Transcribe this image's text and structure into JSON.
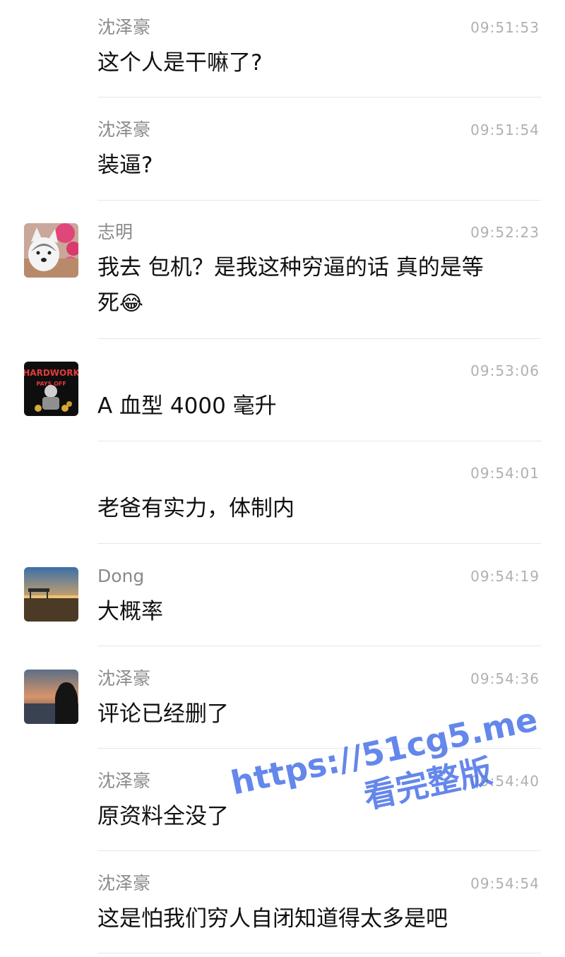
{
  "messages": [
    {
      "sender": "沈泽豪",
      "time": "09:51:53",
      "text": "这个人是干嘛了?"
    },
    {
      "sender": "沈泽豪",
      "time": "09:51:54",
      "text": "装逼?"
    },
    {
      "sender": "志明",
      "time": "09:52:23",
      "text": "我去 包机？是我这种穷逼的话 真的是等",
      "text2": "死",
      "emoji": "😂",
      "avatar": "husky-dog-avatar"
    },
    {
      "sender": "",
      "time": "09:53:06",
      "text": "A 血型 4000 毫升",
      "avatar": "hardwork-pays-off-avatar",
      "avatar_text_1": "HARDWORK",
      "avatar_text_2": "PAYS OFF"
    },
    {
      "sender": "",
      "time": "09:54:01",
      "text": "老爸有实力，体制内"
    },
    {
      "sender": "Dong",
      "time": "09:54:19",
      "text": "大概率",
      "avatar": "sunset-landscape-avatar"
    },
    {
      "sender": "沈泽豪",
      "time": "09:54:36",
      "text": "评论已经删了",
      "avatar": "silhouette-sunset-avatar"
    },
    {
      "sender": "沈泽豪",
      "time": "09:54:40",
      "text": "原资料全没了"
    },
    {
      "sender": "沈泽豪",
      "time": "09:54:54",
      "text": "这是怕我们穷人自闭知道得太多是吧"
    }
  ],
  "watermark": {
    "url": "https://51cg5.me",
    "subtitle": "看完整版"
  },
  "colors": {
    "sender": "#8a8a8a",
    "time": "#b0b0b0",
    "text": "#111111",
    "divider": "#e6e6e6",
    "watermark": "#4a73e8"
  }
}
